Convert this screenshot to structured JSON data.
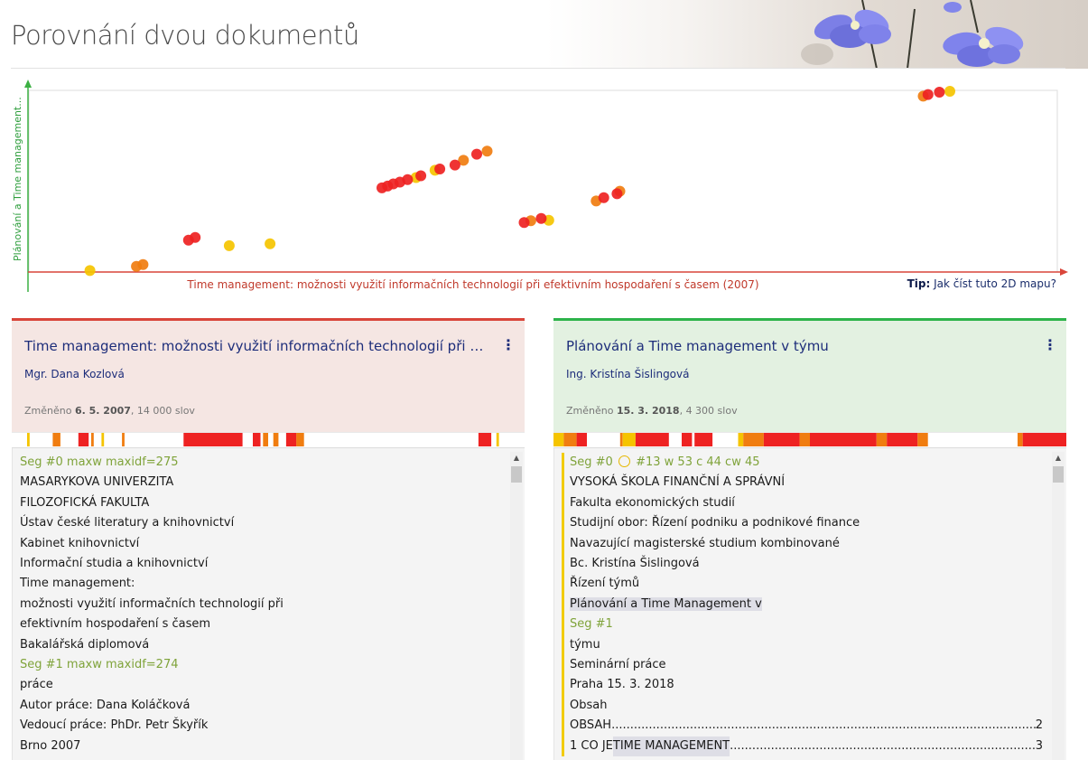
{
  "page": {
    "title": "Porovnání dvou dokumentů"
  },
  "tip": {
    "label": "Tip:",
    "link": "Jak číst tuto 2D mapu?"
  },
  "colors": {
    "left_accent": "#d9453a",
    "right_accent": "#2db34a",
    "dot_red": "#ee2222",
    "dot_orange": "#f07d10",
    "dot_yellow": "#f5c400",
    "segment_green": "#7fa33a",
    "link_blue": "#1d2d7a"
  },
  "chart_data": {
    "type": "scatter",
    "xlabel": "Time management: možnosti využití informačních technologií při efektivním hospodaření s časem (2007)",
    "ylabel": "Plánování a Time management...",
    "xlim": [
      0,
      100
    ],
    "ylim": [
      0,
      100
    ],
    "series": [
      {
        "color": "red",
        "points": [
          [
            13.6,
            17.0
          ],
          [
            14.3,
            18.5
          ],
          [
            34.0,
            45.8
          ],
          [
            34.6,
            46.8
          ],
          [
            35.2,
            48.0
          ],
          [
            35.9,
            49.0
          ],
          [
            36.7,
            50.4
          ],
          [
            38.1,
            52.5
          ],
          [
            40.1,
            56.2
          ],
          [
            41.7,
            58.4
          ],
          [
            44.0,
            64.4
          ],
          [
            49.0,
            26.7
          ],
          [
            50.8,
            29.0
          ],
          [
            57.4,
            40.4
          ],
          [
            58.8,
            42.6
          ],
          [
            91.6,
            97.2
          ],
          [
            92.8,
            98.5
          ]
        ]
      },
      {
        "color": "orange",
        "points": [
          [
            8.1,
            2.6
          ],
          [
            8.8,
            3.6
          ],
          [
            42.6,
            61.0
          ],
          [
            45.1,
            66.0
          ],
          [
            49.7,
            27.7
          ],
          [
            56.6,
            38.6
          ],
          [
            59.1,
            44.0
          ],
          [
            91.1,
            96.3
          ]
        ]
      },
      {
        "color": "yellow",
        "points": [
          [
            3.2,
            0.3
          ],
          [
            17.9,
            14.0
          ],
          [
            22.2,
            15.0
          ],
          [
            37.6,
            51.5
          ],
          [
            39.6,
            55.5
          ],
          [
            51.6,
            28.0
          ],
          [
            93.9,
            99.0
          ]
        ]
      }
    ]
  },
  "left_doc": {
    "title": "Time management: možnosti využití informačních technologií při efekti…",
    "author": "Mgr. Dana Kozlová",
    "changed_label": "Změněno",
    "changed_date": "6. 5. 2007",
    "word_count": "14 000 slov",
    "heatbar": [
      {
        "from": 0.03,
        "to": 0.035,
        "color": "yellow"
      },
      {
        "from": 0.08,
        "to": 0.095,
        "color": "orange"
      },
      {
        "from": 0.13,
        "to": 0.15,
        "color": "red"
      },
      {
        "from": 0.155,
        "to": 0.16,
        "color": "orange"
      },
      {
        "from": 0.175,
        "to": 0.18,
        "color": "yellow"
      },
      {
        "from": 0.215,
        "to": 0.22,
        "color": "orange"
      },
      {
        "from": 0.335,
        "to": 0.45,
        "color": "red"
      },
      {
        "from": 0.47,
        "to": 0.485,
        "color": "red"
      },
      {
        "from": 0.49,
        "to": 0.5,
        "color": "orange"
      },
      {
        "from": 0.51,
        "to": 0.52,
        "color": "orange"
      },
      {
        "from": 0.535,
        "to": 0.555,
        "color": "red"
      },
      {
        "from": 0.555,
        "to": 0.57,
        "color": "orange"
      },
      {
        "from": 0.91,
        "to": 0.935,
        "color": "red"
      },
      {
        "from": 0.945,
        "to": 0.95,
        "color": "yellow"
      }
    ],
    "lines": [
      {
        "text": "Seg #0 maxw maxidf=275",
        "seg": true
      },
      {
        "text": "MASARYKOVA UNIVERZITA"
      },
      {
        "text": "FILOZOFICKÁ FAKULTA"
      },
      {
        "text": "Ústav české literatury a knihovnictví"
      },
      {
        "text": "Kabinet knihovnictví"
      },
      {
        "text": "Informační studia a knihovnictví"
      },
      {
        "text": "Time management:"
      },
      {
        "text": "možnosti využití informačních technologií při"
      },
      {
        "text": "efektivním hospodaření s časem"
      },
      {
        "text": "Bakalářská diplomová"
      },
      {
        "text": "Seg #1 maxw maxidf=274",
        "seg": true
      },
      {
        "text": "práce"
      },
      {
        "text": "Autor práce: Dana Koláčková"
      },
      {
        "text": "Vedoucí práce: PhDr. Petr Škyřík"
      },
      {
        "text": "Brno 2007"
      }
    ]
  },
  "right_doc": {
    "title": "Plánování a Time management v týmu",
    "author": "Ing. Kristína Šislingová",
    "changed_label": "Změněno",
    "changed_date": "15. 3. 2018",
    "word_count": "4 300 slov",
    "heatbar": [
      {
        "from": 0.0,
        "to": 0.02,
        "color": "yellow"
      },
      {
        "from": 0.02,
        "to": 0.045,
        "color": "orange"
      },
      {
        "from": 0.045,
        "to": 0.065,
        "color": "red"
      },
      {
        "from": 0.13,
        "to": 0.135,
        "color": "orange"
      },
      {
        "from": 0.135,
        "to": 0.16,
        "color": "yellow"
      },
      {
        "from": 0.16,
        "to": 0.225,
        "color": "red"
      },
      {
        "from": 0.25,
        "to": 0.27,
        "color": "red"
      },
      {
        "from": 0.275,
        "to": 0.31,
        "color": "red"
      },
      {
        "from": 0.36,
        "to": 0.37,
        "color": "yellow"
      },
      {
        "from": 0.37,
        "to": 0.41,
        "color": "orange"
      },
      {
        "from": 0.41,
        "to": 0.48,
        "color": "red"
      },
      {
        "from": 0.48,
        "to": 0.5,
        "color": "orange"
      },
      {
        "from": 0.5,
        "to": 0.63,
        "color": "red"
      },
      {
        "from": 0.63,
        "to": 0.65,
        "color": "orange"
      },
      {
        "from": 0.65,
        "to": 0.71,
        "color": "red"
      },
      {
        "from": 0.71,
        "to": 0.73,
        "color": "orange"
      },
      {
        "from": 0.905,
        "to": 0.915,
        "color": "orange"
      },
      {
        "from": 0.915,
        "to": 1.0,
        "color": "red"
      }
    ],
    "segment_header": {
      "seg": "Seg #0",
      "detail": "#13 w 53 c 44 cw 45",
      "icon": "circle-icon"
    },
    "lines": [
      {
        "text": "VYSOKÁ ŠKOLA FINANČNÍ A SPRÁVNÍ"
      },
      {
        "text": "Fakulta ekonomických studií"
      },
      {
        "text": "Studijní obor: Řízení podniku a podnikové finance"
      },
      {
        "text": "Navazující magisterské studium kombinované"
      },
      {
        "text": "Bc. Kristína Šislingová"
      },
      {
        "text": "Řízení týmů"
      },
      {
        "text": "Plánování a Time Management v",
        "hl": true
      },
      {
        "text": "Seg #1",
        "seg": true
      },
      {
        "text": "týmu"
      },
      {
        "text": "Seminární práce"
      },
      {
        "text": "Praha 15. 3. 2018"
      },
      {
        "text": "Obsah"
      },
      {
        "text": "OBSAH",
        "toc_page": "2"
      },
      {
        "text": "1 CO JE",
        "toc_hl": "TIME MANAGEMENT",
        "toc_page": "3"
      }
    ]
  }
}
